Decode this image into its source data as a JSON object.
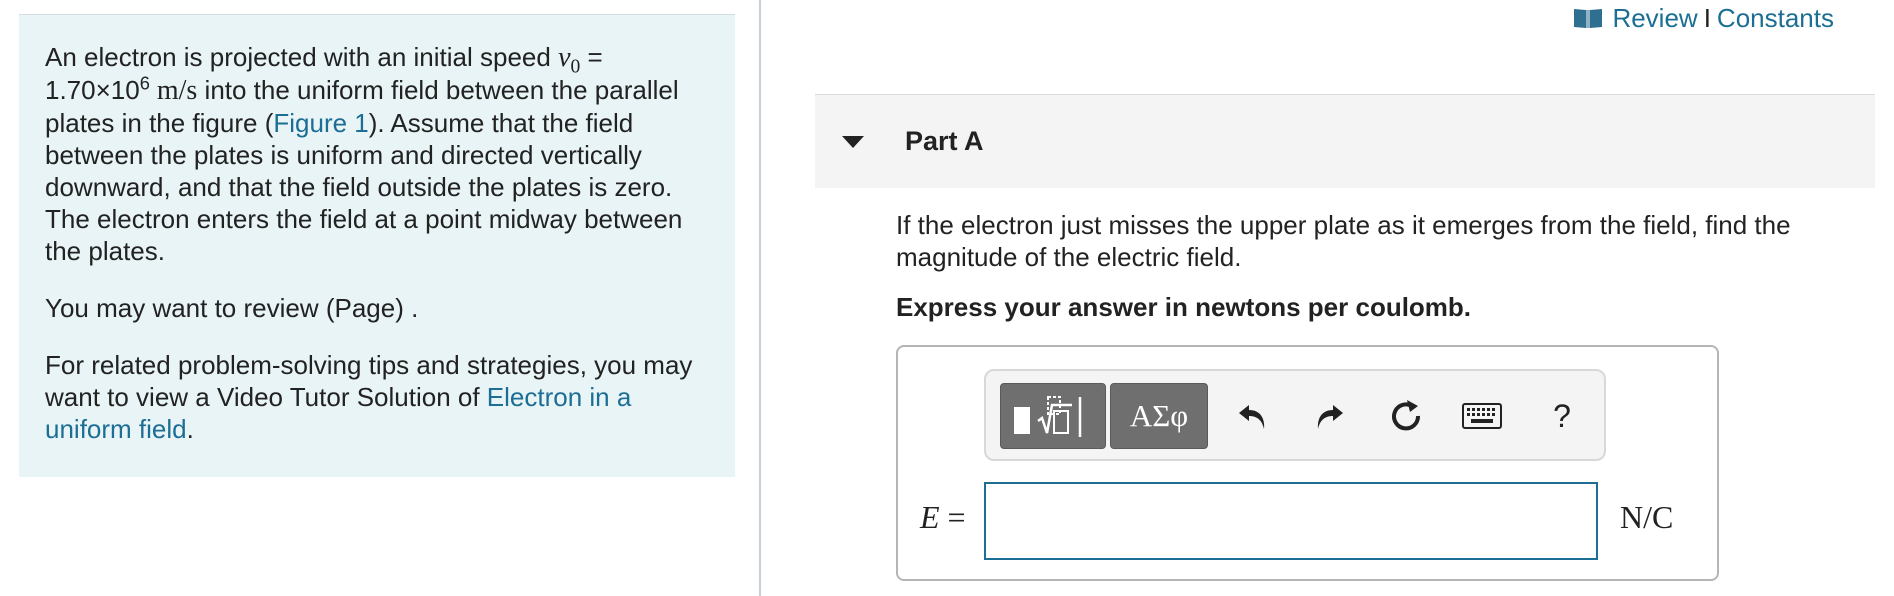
{
  "top_links": {
    "review": "Review",
    "separator": "I",
    "constants": "Constants",
    "icon": "open-book-icon"
  },
  "intro": {
    "p1_before_math": "An electron is projected with an initial speed ",
    "p1_var": "v",
    "p1_sub": "0",
    "p1_eq": " = ",
    "p1_mantissa": "1.70×10",
    "p1_exp": "6",
    "p1_unit": " m/s",
    "p1_after_unit": " into the uniform field between the parallel plates in the figure (",
    "figure_link": "Figure 1",
    "p1_rest": "). Assume that the field between the plates is uniform and directed vertically downward, and that the field outside the plates is zero. The electron enters the field at a point midway between the plates.",
    "p2": "You may want to review (Page) .",
    "p3_before_link": "For related problem-solving tips and strategies, you may want to view a Video Tutor Solution of ",
    "video_link": "Electron in a uniform field",
    "p3_end": "."
  },
  "part": {
    "title": "Part A",
    "question": "If the electron just misses the upper plate as it emerges from the field, find the magnitude of the electric field.",
    "instruction": "Express your answer in newtons per coulomb."
  },
  "toolbar": {
    "symbols_label": "ΑΣφ",
    "help_label": "?",
    "icons": [
      "templates-icon",
      "undo-icon",
      "redo-icon",
      "reset-icon",
      "keyboard-icon"
    ]
  },
  "answer": {
    "variable": "E",
    "equals": " =",
    "value": "",
    "unit": "N/C"
  },
  "colors": {
    "link": "#1c6e94",
    "intro_bg": "#e8f4f6",
    "tool_button": "#6f6f6f"
  }
}
